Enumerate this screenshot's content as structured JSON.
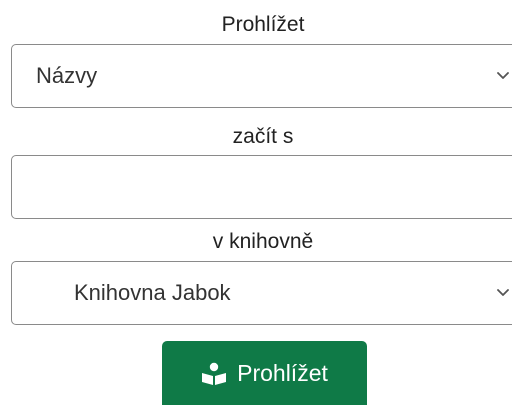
{
  "browse": {
    "heading": "Prohlížet",
    "by_selected": "Názvy"
  },
  "starts_with": {
    "label": "začít s",
    "value": ""
  },
  "library": {
    "label": "v knihovně",
    "selected": "Knihovna Jabok"
  },
  "submit": {
    "label": "Prohlížet",
    "icon": "reader-book-icon",
    "color": "#0f7a47"
  }
}
